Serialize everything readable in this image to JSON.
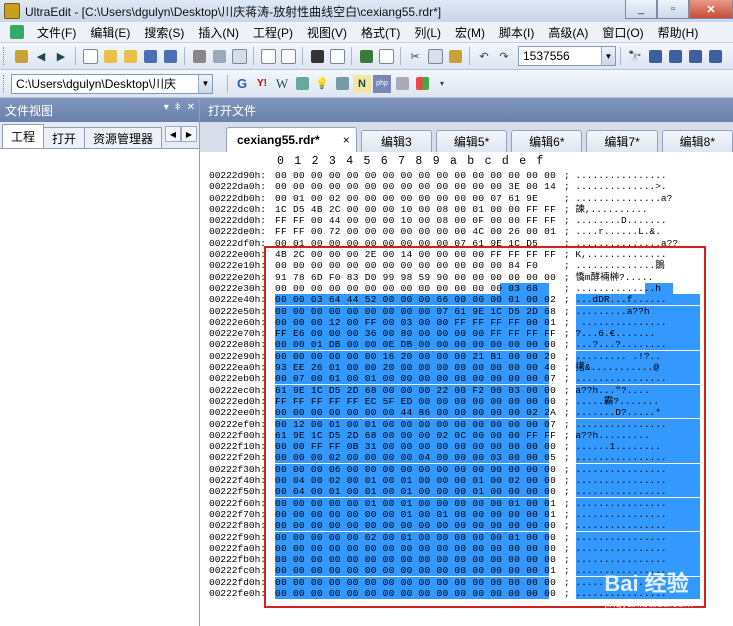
{
  "window": {
    "title": "UltraEdit - [C:\\Users\\dgulyn\\Desktop\\川庆蒋涛-放射性曲线空白\\cexiang55.rdr*]",
    "buttons": [
      "_",
      "▫",
      "✕"
    ]
  },
  "menu": [
    "文件(F)",
    "编辑(E)",
    "搜索(S)",
    "插入(N)",
    "工程(P)",
    "视图(V)",
    "格式(T)",
    "列(L)",
    "宏(M)",
    "脚本(I)",
    "高级(A)",
    "窗口(O)",
    "帮助(H)"
  ],
  "toolbar": {
    "goto_value": "1537556",
    "path_combo": "C:\\Users\\dgulyn\\Desktop\\川庆"
  },
  "left_panel": {
    "title": "文件视图",
    "tabs": [
      "工程",
      "打开",
      "资源管理器"
    ]
  },
  "right_panel": {
    "title": "打开文件",
    "active_tab": "cexiang55.rdr*",
    "tab_close": "×",
    "tabs": [
      "编辑3",
      "编辑5*",
      "编辑6*",
      "编辑7*",
      "编辑8*"
    ]
  },
  "hex_header": [
    "0",
    "1",
    "2",
    "3",
    "4",
    "5",
    "6",
    "7",
    "8",
    "9",
    "a",
    "b",
    "c",
    "d",
    "e",
    "f"
  ],
  "hex_rows": [
    {
      "addr": "00222d90h:",
      "bytes": "00 00 00 00 00 00 00 00 00 00 00 00 00 00 00 00",
      "ascii": "; ................"
    },
    {
      "addr": "00222da0h:",
      "bytes": "00 00 00 00 00 00 00 00 00 00 00 00 00 3E 00 14",
      "ascii": "; ..............>."
    },
    {
      "addr": "00222db0h:",
      "bytes": "00 01 00 02 00 00 00 00 00 00 00 00 07 61 9E",
      "ascii": "; ...............a?"
    },
    {
      "addr": "00222dc0h:",
      "bytes": "1C D5 4B 2C 00 00 00 10 00 08 00 01 00 00 FF FF",
      "ascii": "; 諫,.........."
    },
    {
      "addr": "00222dd0h:",
      "bytes": "FF FF 00 44 00 00 00 10 00 08 00 0F 00 00 FF FF",
      "ascii": "; ........D......."
    },
    {
      "addr": "00222de0h:",
      "bytes": "FF FF 00 72 00 00 00 00 00 00 00 4C 00 26 00 01",
      "ascii": "; ....r......L.&."
    },
    {
      "addr": "00222df0h:",
      "bytes": "00 01 00 00 00 00 00 00 00 00 07 61 9E 1C D5",
      "ascii": "; ...............a??"
    },
    {
      "addr": "00222e00h:",
      "bytes": "4B 2C 00 00 00 2E 00 14 00 00 00 00 FF FF FF FF",
      "ascii": "; K,.............."
    },
    {
      "addr": "00222e10h:",
      "bytes": "00 00 00 00 00 00 00 00 00 00 00 00 00 84 F0",
      "ascii": "; ..............鶵"
    },
    {
      "addr": "00222e20h:",
      "bytes": "91 78 6D F0 83 D0 99 98 59 90 00 00 00 00 00 00",
      "ascii": "; 憍m酵裲榊?....."
    },
    {
      "addr": "00222e30h:",
      "bytes": "00 00 00 00 00 00 00 00 00 00 00 00 00 03 68",
      "ascii": "; ..............h",
      "sel": [
        13,
        16
      ]
    },
    {
      "addr": "00222e40h:",
      "bytes": "00 00 03 64 44 52 00 00 00 66 00 00 00 01 00 02",
      "ascii": "; ...dDR...f......",
      "sel": [
        0,
        16
      ]
    },
    {
      "addr": "00222e50h:",
      "bytes": "00 00 00 00 00 00 00 00 00 07 61 9E 1C D5 2D 68",
      "ascii": "; .........a??h",
      "sel": [
        0,
        16
      ]
    },
    {
      "addr": "00222e60h:",
      "bytes": "00 00 00 12 00 FF 00 03 00 00 FF FF FF FF 00 01",
      "ascii": ";  ...............",
      "sel": [
        0,
        16
      ]
    },
    {
      "addr": "00222e70h:",
      "bytes": "FF E6 00 00 00 36 00 80 00 00 00 00 FF FF FF FF",
      "ascii": "; ?...6.€.......",
      "sel": [
        0,
        16
      ]
    },
    {
      "addr": "00222e80h:",
      "bytes": "00 00 01 DB 00 00 0E DB 00 00 00 00 00 00 00 00",
      "ascii": "; ...?...?........",
      "sel": [
        0,
        16
      ]
    },
    {
      "addr": "00222e90h:",
      "bytes": "00 00 00 00 00 00 16 20 00 00 00 21 B1 00 00 20",
      "ascii": "; ......... .!?..",
      "sel": [
        0,
        16
      ]
    },
    {
      "addr": "00222ea0h:",
      "bytes": "93 EE 26 01 00 00 20 00 00 00 00 00 00 00 00 40",
      "ascii": "; 擆&...........@",
      "sel": [
        0,
        16
      ]
    },
    {
      "addr": "00222eb0h:",
      "bytes": "00 07 00 01 00 01 00 00 00 00 00 00 00 00 00 07",
      "ascii": "; ................",
      "sel": [
        0,
        16
      ]
    },
    {
      "addr": "00222ec0h:",
      "bytes": "61 9E 1C D5 2D 68 00 00 00 22 00 F2 00 03 00 00",
      "ascii": "; a??h...\"?....",
      "sel": [
        0,
        16
      ]
    },
    {
      "addr": "00222ed0h:",
      "bytes": "FF FF FF FF FF EC 5F ED 00 00 00 00 00 00 00 00",
      "ascii": "; .....霸?.......",
      "sel": [
        0,
        16
      ]
    },
    {
      "addr": "00222ee0h:",
      "bytes": "00 00 00 00 00 00 00 44 86 00 00 00 00 00 02 2A",
      "ascii": "; .......D?.....*",
      "sel": [
        0,
        16
      ]
    },
    {
      "addr": "00222ef0h:",
      "bytes": "00 12 00 01 00 01 00 00 00 00 00 00 00 00 00 07",
      "ascii": "; ................",
      "sel": [
        0,
        16
      ]
    },
    {
      "addr": "00222f00h:",
      "bytes": "61 9E 1C D5 2D 68 00 00 00 02 0C 00 00 00 FF FF",
      "ascii": "; a??h.........",
      "sel": [
        0,
        16
      ]
    },
    {
      "addr": "00222f10h:",
      "bytes": "00 00 FF FF 0B 31 00 00 00 00 00 00 00 00 00 00",
      "ascii": "; ......1........",
      "sel": [
        0,
        16
      ]
    },
    {
      "addr": "00222f20h:",
      "bytes": "00 00 00 02 00 00 00 00 04 00 00 00 03 00 00 05",
      "ascii": "; ................",
      "sel": [
        0,
        16
      ]
    },
    {
      "addr": "00222f30h:",
      "bytes": "00 00 00 06 00 00 00 00 00 00 00 00 00 00 00 00",
      "ascii": "; ................",
      "sel": [
        0,
        16
      ]
    },
    {
      "addr": "00222f40h:",
      "bytes": "00 04 00 02 00 01 00 01 00 00 00 01 00 02 00 00",
      "ascii": "; ................",
      "sel": [
        0,
        16
      ]
    },
    {
      "addr": "00222f50h:",
      "bytes": "00 04 00 01 00 01 00 01 00 00 00 01 00 00 00 00",
      "ascii": "; ................",
      "sel": [
        0,
        16
      ]
    },
    {
      "addr": "00222f60h:",
      "bytes": "00 00 00 00 00 01 00 01 00 00 00 00 00 01 00 01",
      "ascii": "; ................",
      "sel": [
        0,
        16
      ]
    },
    {
      "addr": "00222f70h:",
      "bytes": "00 00 00 00 00 00 00 01 00 01 00 00 00 00 00 01",
      "ascii": "; ................",
      "sel": [
        0,
        16
      ]
    },
    {
      "addr": "00222f80h:",
      "bytes": "00 00 00 00 00 00 00 00 00 00 00 00 00 00 00 00",
      "ascii": "; ................",
      "sel": [
        0,
        16
      ]
    },
    {
      "addr": "00222f90h:",
      "bytes": "00 00 00 00 00 02 00 01 00 00 00 00 00 01 00 00",
      "ascii": "; ................",
      "sel": [
        0,
        16
      ]
    },
    {
      "addr": "00222fa0h:",
      "bytes": "00 00 00 00 00 00 00 00 00 00 00 00 00 00 00 00",
      "ascii": "; ................",
      "sel": [
        0,
        16
      ]
    },
    {
      "addr": "00222fb0h:",
      "bytes": "00 00 00 00 00 00 00 00 00 00 00 00 00 00 00 00",
      "ascii": "; ................",
      "sel": [
        0,
        16
      ]
    },
    {
      "addr": "00222fc0h:",
      "bytes": "00 00 00 00 00 00 00 00 00 00 00 00 00 00 00 01",
      "ascii": "; ................",
      "sel": [
        0,
        16
      ]
    },
    {
      "addr": "00222fd0h:",
      "bytes": "00 00 00 00 00 00 00 00 00 00 00 00 00 00 00 00",
      "ascii": "; ................",
      "sel": [
        0,
        16
      ]
    },
    {
      "addr": "00222fe0h:",
      "bytes": "00 00 00 00 00 00 00 00 00 00 00 00 00 00 00 00",
      "ascii": "; ................",
      "sel": [
        0,
        16
      ]
    }
  ],
  "watermark": {
    "brand": "Bai 经验",
    "url": "jingyan.baidu.com"
  },
  "colors": {
    "selection": "#3399ff",
    "highlight_box": "#d42020",
    "panel_header": "#7088b2"
  }
}
